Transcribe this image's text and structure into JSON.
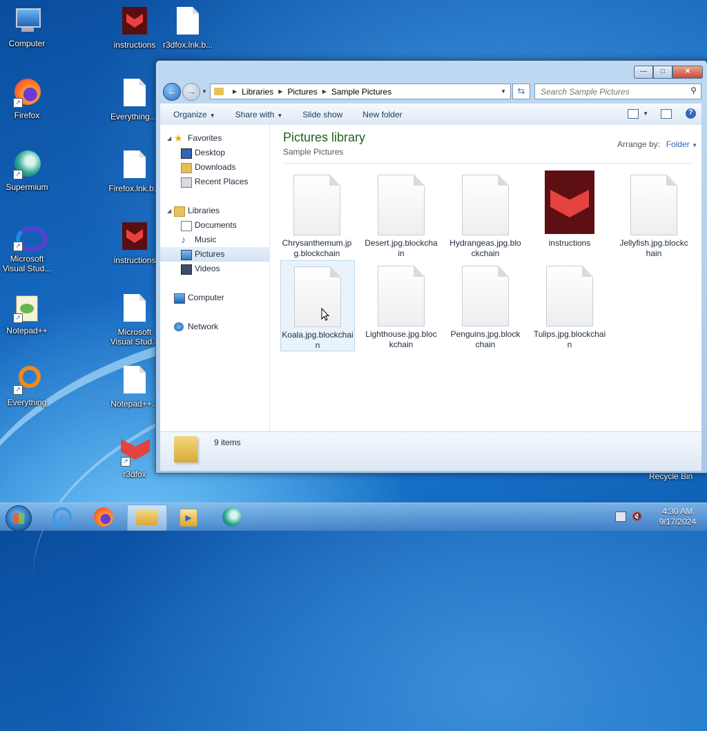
{
  "desktop": {
    "icons": [
      {
        "label": "Computer"
      },
      {
        "label": "instructions"
      },
      {
        "label": "r3dfox.lnk.b..."
      },
      {
        "label": "Firefox"
      },
      {
        "label": "Everything...."
      },
      {
        "label": "Supermium"
      },
      {
        "label": "Firefox.lnk.b..."
      },
      {
        "label": "Microsoft Visual Stud..."
      },
      {
        "label": "instructions"
      },
      {
        "label": "Notepad++"
      },
      {
        "label": "Microsoft Visual Stud..."
      },
      {
        "label": "Everything"
      },
      {
        "label": "Notepad++..."
      },
      {
        "label": "r3dfox"
      }
    ],
    "recycle_bin": "Recycle Bin"
  },
  "explorer": {
    "address": {
      "crumbs": [
        "Libraries",
        "Pictures",
        "Sample Pictures"
      ]
    },
    "search_placeholder": "Search Sample Pictures",
    "toolbar": {
      "organize": "Organize",
      "share_with": "Share with",
      "slide_show": "Slide show",
      "new_folder": "New folder"
    },
    "nav": {
      "favorites": "Favorites",
      "desktop": "Desktop",
      "downloads": "Downloads",
      "recent_places": "Recent Places",
      "libraries": "Libraries",
      "documents": "Documents",
      "music": "Music",
      "pictures": "Pictures",
      "videos": "Videos",
      "computer": "Computer",
      "network": "Network"
    },
    "library": {
      "title": "Pictures library",
      "subtitle": "Sample Pictures",
      "arrange_label": "Arrange by:",
      "arrange_value": "Folder"
    },
    "files": [
      {
        "name": "Chrysanthemum.jpg.blockchain"
      },
      {
        "name": "Desert.jpg.blockchain"
      },
      {
        "name": "Hydrangeas.jpg.blockchain"
      },
      {
        "name": "instructions"
      },
      {
        "name": "Jellyfish.jpg.blockchain"
      },
      {
        "name": "Koala.jpg.blockchain"
      },
      {
        "name": "Lighthouse.jpg.blockchain"
      },
      {
        "name": "Penguins.jpg.blockchain"
      },
      {
        "name": "Tulips.jpg.blockchain"
      }
    ],
    "details": {
      "count": "9 items"
    }
  },
  "taskbar": {
    "time": "4:30 AM",
    "date": "9/17/2024"
  }
}
